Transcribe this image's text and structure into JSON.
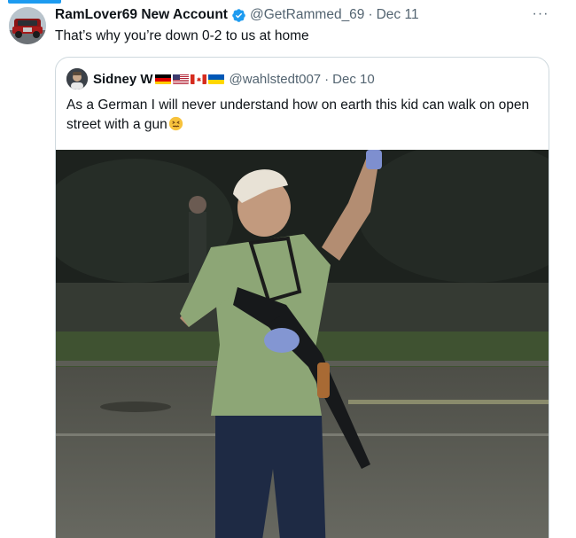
{
  "tweet": {
    "display_name": "RamLover69 New Account",
    "handle": "@GetRammed_69",
    "separator": "·",
    "time": "Dec 11",
    "more_label": "···",
    "text": "That’s why you’re down 0-2 to us at home",
    "avatar_icon": "truck-avatar-icon",
    "verified_icon": "verified-badge-icon"
  },
  "quote": {
    "display_name": "Sidney W",
    "flags": [
      "germany-flag-icon",
      "usa-flag-icon",
      "canada-flag-icon",
      "ukraine-flag-icon"
    ],
    "handle": "@wahlstedt007",
    "separator": "·",
    "time": "Dec 10",
    "text": "As a German I will never understand how on earth this kid can walk on open street with a gun",
    "emoji_icon": "confounded-face-emoji",
    "media_icon": "photo-man-with-rifle-night-street"
  },
  "colors": {
    "accent": "#1d9bf0",
    "text": "#0f1419",
    "secondary_text": "#536471",
    "border": "#cfd9de"
  }
}
